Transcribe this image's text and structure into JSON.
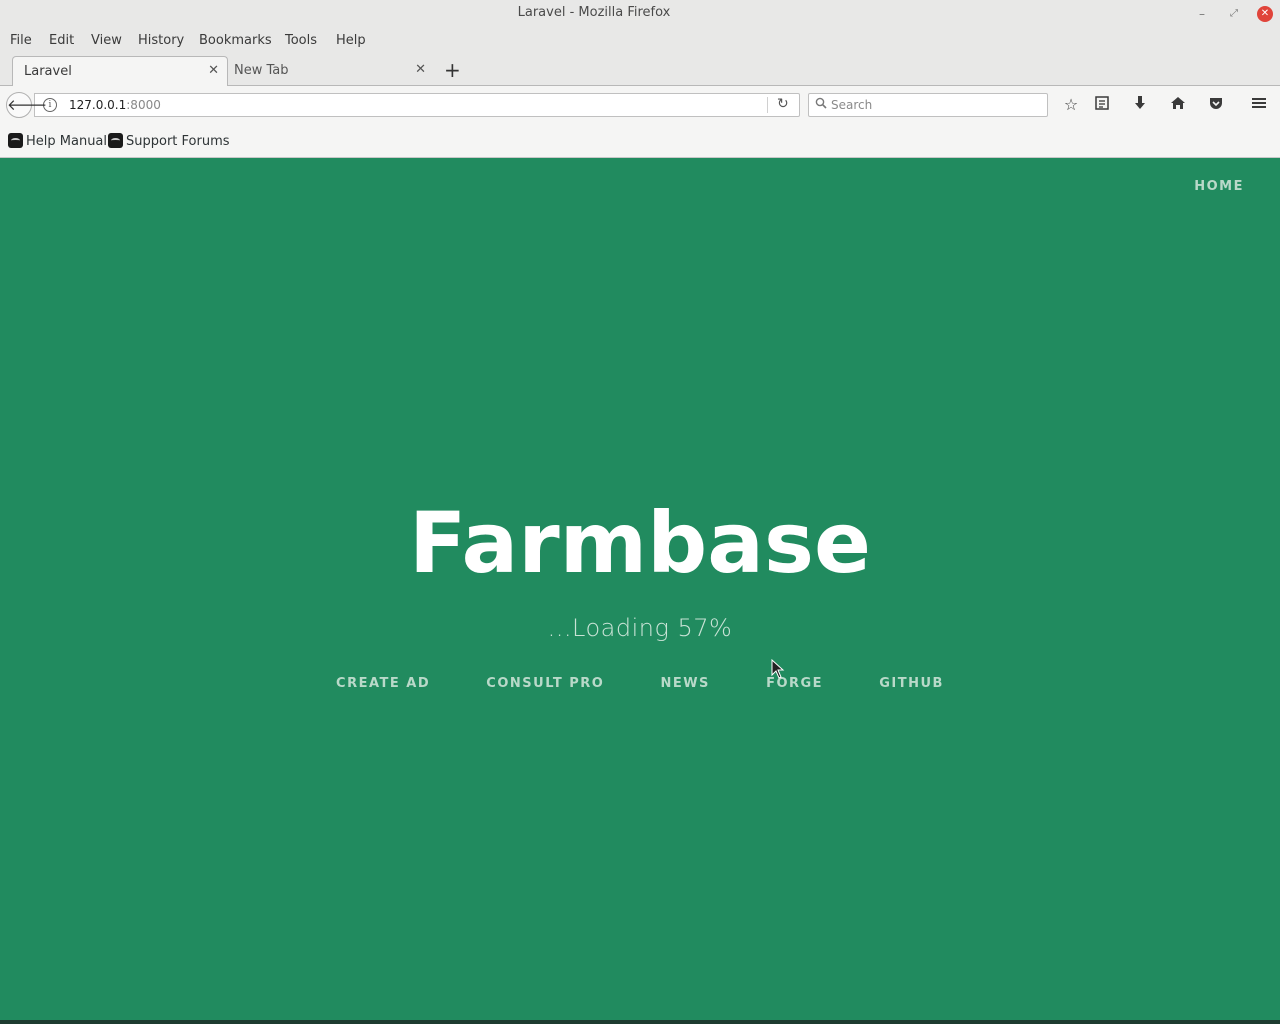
{
  "window": {
    "title": "Laravel - Mozilla Firefox"
  },
  "menu": [
    "File",
    "Edit",
    "View",
    "History",
    "Bookmarks",
    "Tools",
    "Help"
  ],
  "tabs": [
    {
      "label": "Laravel",
      "active": true
    },
    {
      "label": "New Tab",
      "active": false
    }
  ],
  "url": {
    "host": "127.0.0.1",
    "port": ":8000"
  },
  "search": {
    "placeholder": "Search"
  },
  "bookmarks": [
    "Help Manual",
    "Support Forums"
  ],
  "page": {
    "nav_home": "HOME",
    "title": "Farmbase",
    "loading": "...Loading 57%",
    "links": [
      "CREATE AD",
      "CONSULT PRO",
      "NEWS",
      "FORGE",
      "GITHUB"
    ]
  },
  "colors": {
    "page_bg": "#218b5f",
    "title": "#ffffff",
    "link": "#b9d9c9"
  },
  "icons": [
    "back-arrow-icon",
    "info-icon",
    "reload-icon",
    "search-icon",
    "bookmark-star-icon",
    "reading-list-icon",
    "download-icon",
    "home-icon",
    "pocket-icon",
    "hamburger-menu-icon"
  ]
}
